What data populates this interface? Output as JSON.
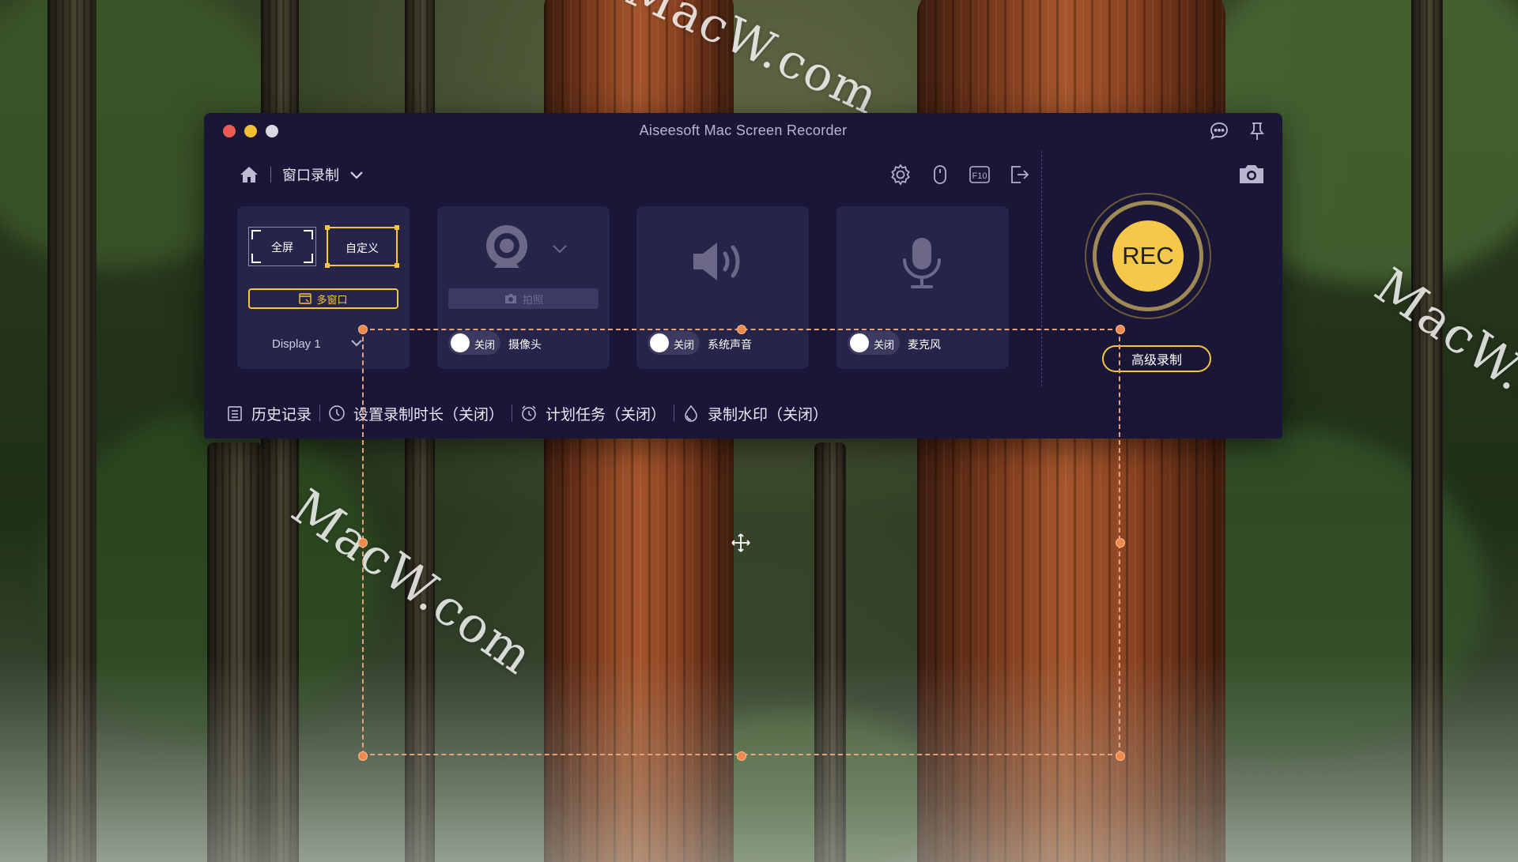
{
  "window": {
    "title": "Aiseesoft Mac Screen Recorder"
  },
  "nav": {
    "mode": "窗口录制"
  },
  "area_card": {
    "full_label": "全屏",
    "custom_label": "自定义",
    "multi_label": "多窗口",
    "display_label": "Display 1"
  },
  "camera_card": {
    "photo_label": "拍照",
    "toggle_state": "关闭",
    "name": "摄像头"
  },
  "system_audio_card": {
    "toggle_state": "关闭",
    "name": "系统声音"
  },
  "mic_card": {
    "toggle_state": "关闭",
    "name": "麦克风"
  },
  "rec": {
    "label": "REC",
    "advanced_label": "高级录制"
  },
  "bottom_bar": {
    "history": "历史记录",
    "duration": "设置录制时长（关闭）",
    "schedule": "计划任务（关闭）",
    "watermark": "录制水印（关闭）"
  },
  "watermark_text": "MacW.com",
  "colors": {
    "accent": "#f4c542",
    "window_bg": "#1a1638",
    "card_bg": "#27244a",
    "region_border": "#e8a27a"
  },
  "icons": [
    "home-icon",
    "chevron-down-icon",
    "settings-icon",
    "mouse-icon",
    "f10-hotkey-icon",
    "export-icon",
    "chat-icon",
    "pin-icon",
    "camera-snapshot-icon",
    "webcam-icon",
    "speaker-icon",
    "microphone-icon",
    "history-icon",
    "clock-icon",
    "alarm-icon",
    "water-drop-icon",
    "move-icon"
  ]
}
